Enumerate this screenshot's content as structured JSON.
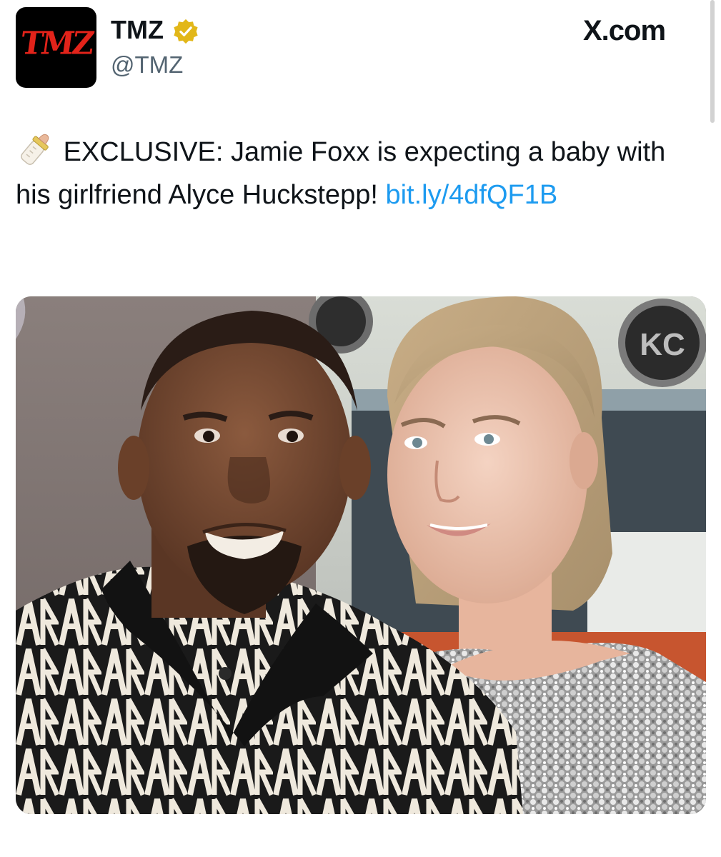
{
  "post": {
    "author": {
      "name": "TMZ",
      "handle": "@TMZ",
      "avatar_text": "TMZ",
      "verified": true
    },
    "site": "X.com",
    "text_icon": "baby-bottle-icon",
    "text_body": "EXCLUSIVE: Jamie Foxx is expecting a baby with his girlfriend Alyce Huckstepp! ",
    "link_text": "bit.ly/​4dfQF1B",
    "photo_signs": {
      "lamp_badge": "KC"
    }
  },
  "colors": {
    "link": "#1d9bf0",
    "handle": "#536471",
    "verified_badge": "#e2b719",
    "avatar_logo": "#e2231a"
  }
}
